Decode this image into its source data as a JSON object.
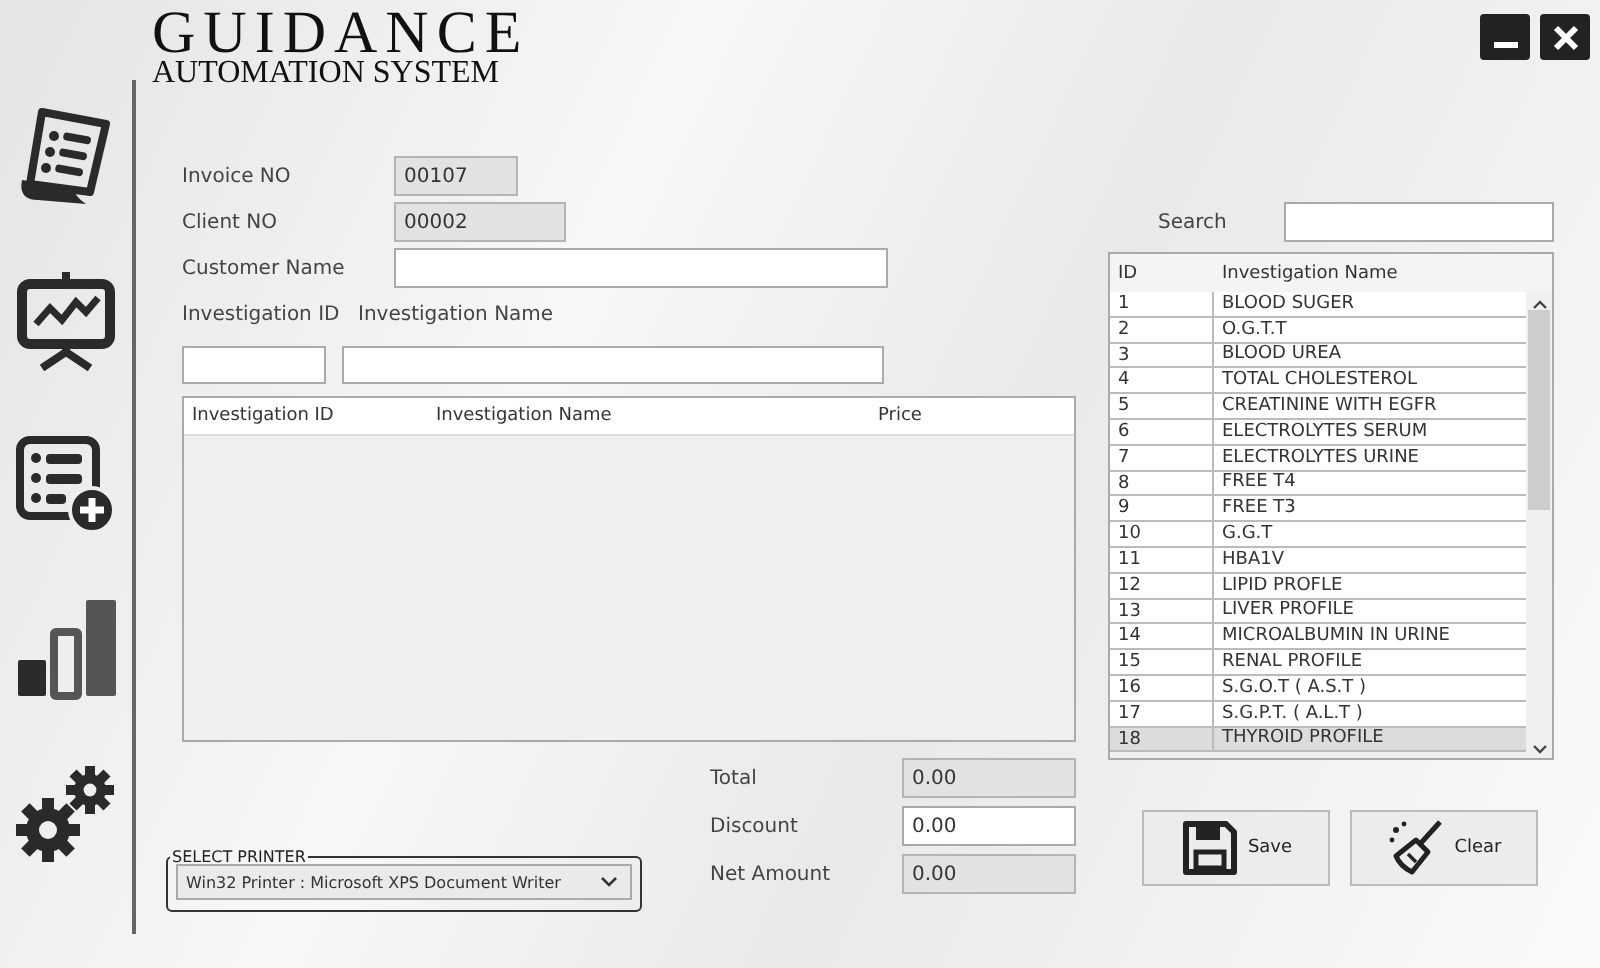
{
  "app": {
    "title": "GUIDANCE",
    "subtitle": "AUTOMATION SYSTEM"
  },
  "form": {
    "fields": [
      {
        "label": "Invoice NO",
        "value": "00107",
        "readonly": true
      },
      {
        "label": "Client NO",
        "value": "00002",
        "readonly": true
      },
      {
        "label": "Customer Name",
        "readonly": false
      }
    ],
    "investigation_id_label": "Investigation ID",
    "investigation_name_label": "Investigation Name"
  },
  "table": {
    "columns": [
      "Investigation ID",
      "Investigation Name",
      "Price"
    ]
  },
  "search": {
    "label": "Search"
  },
  "list": {
    "columns": [
      "ID",
      "Investigation Name"
    ],
    "rows": [
      {
        "id": "1",
        "name": "BLOOD SUGER",
        "selected": false
      },
      {
        "id": "2",
        "name": "O.G.T.T",
        "selected": false
      },
      {
        "id": "3",
        "name": "BLOOD UREA",
        "selected": false
      },
      {
        "id": "4",
        "name": "TOTAL CHOLESTEROL",
        "selected": false
      },
      {
        "id": "5",
        "name": "CREATININE WITH EGFR",
        "selected": false
      },
      {
        "id": "6",
        "name": "ELECTROLYTES SERUM",
        "selected": false
      },
      {
        "id": "7",
        "name": "ELECTROLYTES URINE",
        "selected": false
      },
      {
        "id": "8",
        "name": "FREE T4",
        "selected": false
      },
      {
        "id": "9",
        "name": "FREE T3",
        "selected": false
      },
      {
        "id": "10",
        "name": "G.G.T",
        "selected": false
      },
      {
        "id": "11",
        "name": "HBA1V",
        "selected": false
      },
      {
        "id": "12",
        "name": "LIPID PROFLE",
        "selected": false
      },
      {
        "id": "13",
        "name": "LIVER PROFILE",
        "selected": false
      },
      {
        "id": "14",
        "name": "MICROALBUMIN IN URINE",
        "selected": false
      },
      {
        "id": "15",
        "name": "RENAL PROFILE",
        "selected": false
      },
      {
        "id": "16",
        "name": "S.G.O.T ( A.S.T )",
        "selected": false
      },
      {
        "id": "17",
        "name": "S.G.P.T. ( A.L.T )",
        "selected": false
      },
      {
        "id": "18",
        "name": "THYROID PROFILE",
        "selected": true
      }
    ]
  },
  "totals": [
    {
      "label": "Total",
      "value": "0.00",
      "readonly": true
    },
    {
      "label": "Discount",
      "value": "0.00",
      "readonly": false
    },
    {
      "label": "Net Amount",
      "value": "0.00",
      "readonly": true
    }
  ],
  "printer": {
    "legend": "SELECT PRINTER",
    "value": "Win32 Printer : Microsoft XPS Document Writer"
  },
  "buttons": [
    {
      "label": "Save",
      "kind": "save"
    },
    {
      "label": "Clear",
      "kind": "clear"
    }
  ]
}
